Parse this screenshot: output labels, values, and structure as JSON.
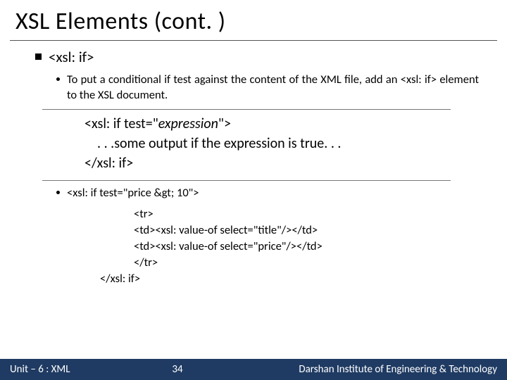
{
  "title": "XSL Elements (cont. )",
  "bullet1": "<xsl: if>",
  "desc1": "To put a conditional if test against the content of the XML file, add an <xsl: if> element to the XSL document.",
  "syntax": {
    "open": "<xsl: if test=\"",
    "expr": "expression",
    "open2": "\">",
    "body": ". . .some output if the expression is true. . .",
    "close": "</xsl: if>"
  },
  "code": {
    "line1": "<xsl: if test=\"price &gt; 10\">",
    "line2": "<tr>",
    "line3": "<td><xsl: value-of select=\"title\"/></td>",
    "line4": "<td><xsl: value-of select=\"price\"/></td>",
    "line5": "</tr>",
    "line6": "</xsl: if>"
  },
  "footer": {
    "left": "Unit – 6 : XML",
    "page": "34",
    "right": "Darshan Institute of Engineering & Technology"
  }
}
